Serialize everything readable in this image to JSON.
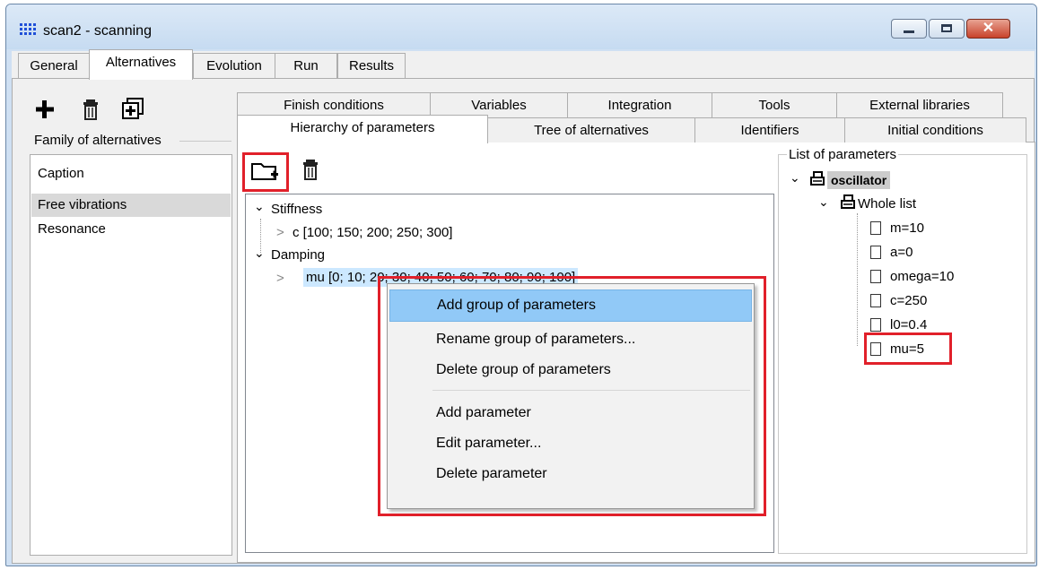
{
  "window": {
    "title": "scan2 - scanning",
    "close_glyph": "✕"
  },
  "top_tabs": [
    "General",
    "Alternatives",
    "Evolution",
    "Run",
    "Results"
  ],
  "left_panel": {
    "group_label": "Family of alternatives",
    "items": [
      "Caption",
      "Free vibrations",
      "Resonance"
    ],
    "selected_index": 1
  },
  "right_tabs_row1": [
    "Finish conditions",
    "Variables",
    "Integration",
    "Tools",
    "External libraries"
  ],
  "right_tabs_row2": [
    "Hierarchy of parameters",
    "Tree of alternatives",
    "Identifiers",
    "Initial conditions"
  ],
  "hierarchy_tree": {
    "groups": [
      {
        "label": "Stiffness",
        "child": "c [100; 150; 200; 250; 300]"
      },
      {
        "label": "Damping",
        "child": "mu [0; 10; 20; 30; 40; 50; 60; 70; 80; 90; 100]"
      }
    ]
  },
  "param_list": {
    "label": "List of parameters",
    "root": "oscillator",
    "subroot": "Whole list",
    "items": [
      "m=10",
      "a=0",
      "omega=10",
      "c=250",
      "l0=0.4",
      "mu=5"
    ]
  },
  "context_menu": {
    "items": [
      "Add group of parameters",
      "Rename group of parameters...",
      "Delete group of parameters",
      "Add parameter",
      "Edit parameter...",
      "Delete parameter"
    ],
    "highlighted_index": 0
  },
  "colors": {
    "highlight": "#e1202a",
    "selection": "#cce8ff",
    "menu_hover": "#91c9f7"
  }
}
